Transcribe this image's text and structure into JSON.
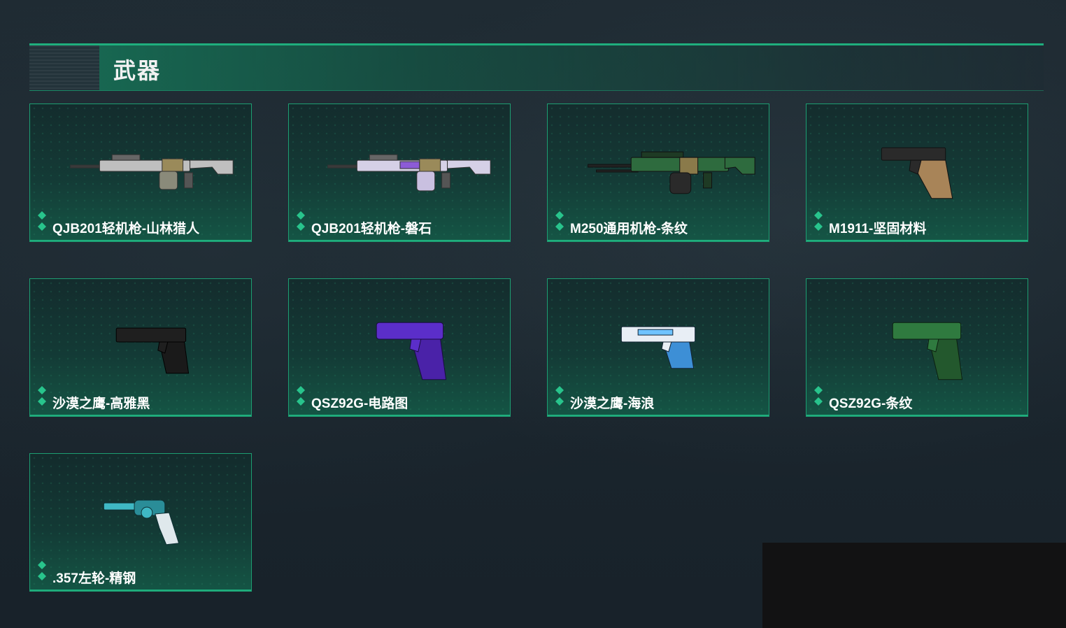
{
  "section": {
    "title": "武器"
  },
  "colors": {
    "accent": "#1fae7d",
    "background": "#1b262e",
    "card_border": "#1d9e72"
  },
  "items": [
    {
      "label": "QJB201轻机枪-山林猎人",
      "icon": "machine-gun-icon",
      "skin_color": "#c8c8c8"
    },
    {
      "label": "QJB201轻机枪-磐石",
      "icon": "machine-gun-icon",
      "skin_color": "#b9a6d8"
    },
    {
      "label": "M250通用机枪-条纹",
      "icon": "machine-gun-icon",
      "skin_color": "#2e6b3e"
    },
    {
      "label": "M1911-坚固材料",
      "icon": "pistol-icon",
      "skin_color": "#2a2a2a"
    },
    {
      "label": "沙漠之鹰-高雅黑",
      "icon": "pistol-icon",
      "skin_color": "#1f1f1f"
    },
    {
      "label": "QSZ92G-电路图",
      "icon": "pistol-icon",
      "skin_color": "#5b2ec9"
    },
    {
      "label": "沙漠之鹰-海浪",
      "icon": "pistol-icon",
      "skin_color": "#3d8fd6"
    },
    {
      "label": "QSZ92G-条纹",
      "icon": "pistol-icon",
      "skin_color": "#2f7a3f"
    },
    {
      "label": ".357左轮-精钢",
      "icon": "revolver-icon",
      "skin_color": "#3fb8c4"
    }
  ]
}
